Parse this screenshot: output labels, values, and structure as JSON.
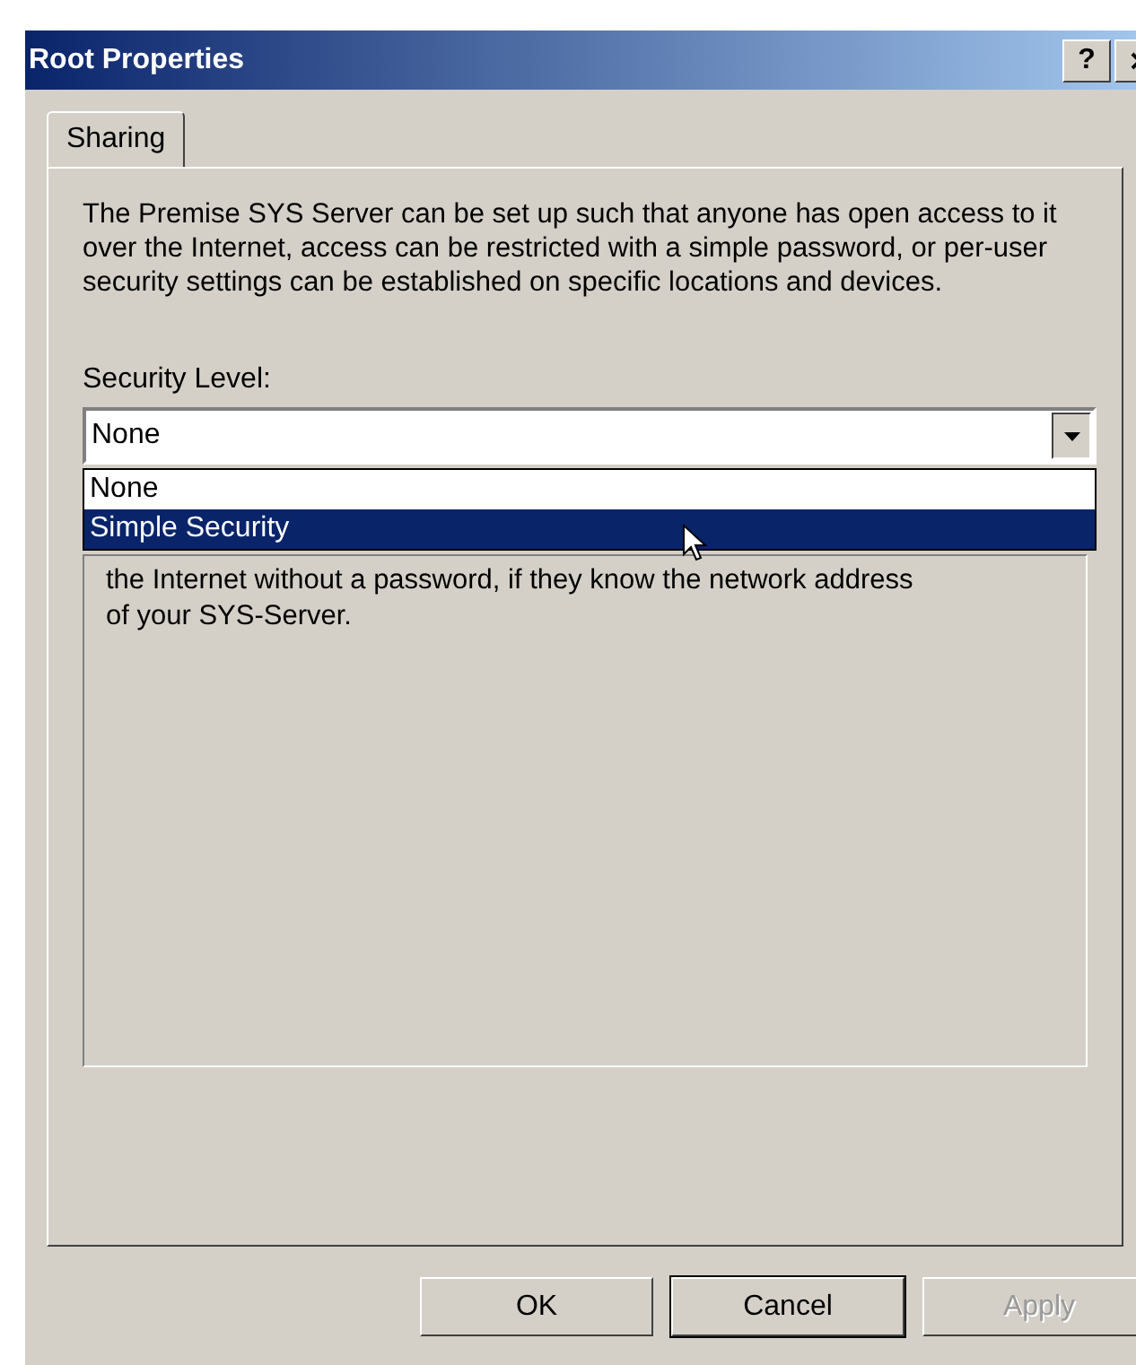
{
  "window": {
    "title": "Root Properties",
    "help_button": "?"
  },
  "tabs": [
    {
      "label": "Sharing",
      "selected": true
    }
  ],
  "intro": "The Premise SYS Server can be set up such that anyone has open access to it over the Internet, access can be restricted with a simple password, or per-user security settings can be established on specific locations and devices.",
  "security_level": {
    "label": "Security Level:",
    "value": "None",
    "expanded": true,
    "options": [
      {
        "label": "None",
        "highlighted": false
      },
      {
        "label": "Simple Security",
        "highlighted": true
      }
    ]
  },
  "description": "the Internet without a password, if they know the network address of your SYS-Server.",
  "buttons": [
    {
      "label": "OK",
      "disabled": false,
      "default": false
    },
    {
      "label": "Cancel",
      "disabled": false,
      "default": true
    },
    {
      "label": "Apply",
      "disabled": true,
      "default": false
    }
  ]
}
